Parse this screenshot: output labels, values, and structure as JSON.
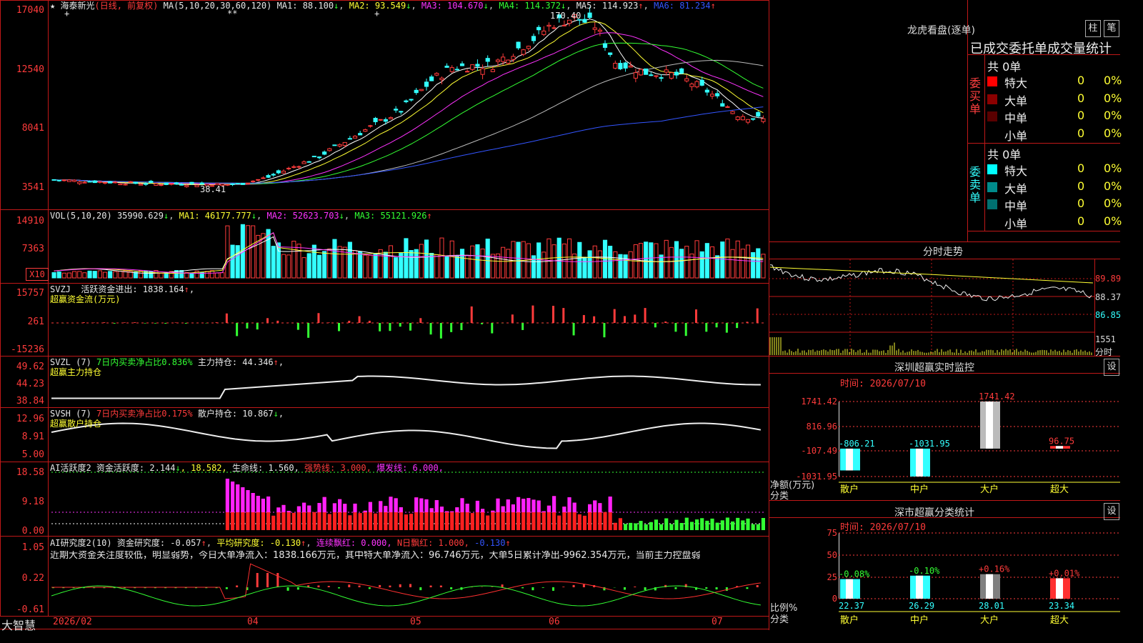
{
  "colors": {
    "up": "#ff3b3b",
    "down": "#33ffff",
    "border": "#c01818",
    "ma1": "#ffffff",
    "ma2": "#ffff33",
    "ma3": "#ff33ff",
    "ma4": "#33ff33",
    "ma5": "#bbbbbb",
    "ma6": "#3355ff"
  },
  "main": {
    "ticks": [
      "17040",
      "12540",
      "8041",
      "3541"
    ],
    "legend": {
      "star": "★",
      "name": "海泰新光",
      "mode": "(日线, 前复权)",
      "ma_def": "MA(5,10,20,30,60,120)",
      "ma1": "MA1: 88.100",
      "ma1_arrow": "↓",
      "ma2": "MA2: 93.549",
      "ma2_arrow": "↓",
      "ma3": "MA3: 104.670",
      "ma3_arrow": "↓",
      "ma4": "MA4: 114.372",
      "ma4_arrow": "↓",
      "ma5": "MA5: 114.923",
      "ma5_arrow": "↑",
      "ma6": "MA6: 81.234",
      "ma6_arrow": "↑"
    },
    "high_label": "170.40",
    "low_label": "38.41",
    "marks": [
      "+",
      "**",
      "+"
    ]
  },
  "vol": {
    "ticks": [
      "14910",
      "7363",
      "X10"
    ],
    "legend": {
      "def": "VOL(5,10,20)",
      "val": "35990.629",
      "val_arrow": "↓",
      "ma1": "MA1: 46177.777",
      "ma1_arrow": "↓",
      "ma2": "MA2: 52623.703",
      "ma2_arrow": "↓",
      "ma3": "MA3: 55121.926",
      "ma3_arrow": "↑"
    }
  },
  "svzj": {
    "ticks": [
      "15757",
      "261",
      "-15236"
    ],
    "legend": {
      "def": "SVZJ",
      "name": "活跃资金进出: 1838.164",
      "arrow": "↑",
      "comma": ",",
      "sub": "超赢资金流(万元)"
    }
  },
  "svzl": {
    "ticks": [
      "49.62",
      "44.23",
      "38.84"
    ],
    "legend": {
      "def": "SVZL  (7)",
      "ratio": "7日内买卖净占比0.836%",
      "hold": "主力持仓: 44.346",
      "arrow": "↑",
      "comma": ",",
      "sub": "超赢主力持仓"
    }
  },
  "svsh": {
    "ticks": [
      "12.96",
      "8.91",
      "5.00"
    ],
    "legend": {
      "def": "SVSH  (7)",
      "ratio": "7日内买卖净占比0.175%",
      "hold": "散户持仓: 10.867",
      "arrow": "↓",
      "comma": ",",
      "sub": "超赢散户持仓"
    }
  },
  "ai1": {
    "ticks": [
      "18.58",
      "9.18",
      "0.00"
    ],
    "legend": {
      "def": "AI活跃度2",
      "act": "资金活跃度: 2.144",
      "act_arrow": "↓",
      "v2": ", 18.582,",
      "life": "生命线: 1.560,",
      "strong": "强势线: 3.000,",
      "burst": "爆发线: 6.000,"
    }
  },
  "ai2": {
    "ticks": [
      "1.05",
      "0.22",
      "-0.61"
    ],
    "legend": {
      "def": "AI研究度2(10)",
      "res": "资金研究度: -0.057",
      "res_arrow": "↑",
      "avg": "平均研究度: -0.130",
      "avg_arrow": "↑",
      "red": "连续飘红: 0.000,",
      "n": "N日飘红: 1.000,",
      "last": "-0.130",
      "last_arrow": "↑"
    },
    "comment": "近期大资金关注度较低，明显弱势，今日大单净流入：1838.166万元，其中特大单净流入：96.746万元，大单5日累计净出-9962.354万元，当前主力控盘弱"
  },
  "dates": {
    "start": "2026/02",
    "labels": [
      "04",
      "05",
      "06",
      "07"
    ]
  },
  "brand": "大智慧",
  "panel": {
    "title": "龙虎看盘(逐单)",
    "btn1": "柱",
    "btn2": "笔",
    "header": "已成交委托单成交量统计",
    "buy_label": "委买单",
    "sell_label": "委卖单",
    "buy_total": "共 0单",
    "sell_total": "共 0单",
    "buy_rows": [
      {
        "name": "特大",
        "count": "0",
        "pct": "0%",
        "color": "#ff0000"
      },
      {
        "name": "大单",
        "count": "0",
        "pct": "0%",
        "color": "#8b0000"
      },
      {
        "name": "中单",
        "count": "0",
        "pct": "0%",
        "color": "#5a0000"
      },
      {
        "name": "小单",
        "count": "0",
        "pct": "0%",
        "color": ""
      }
    ],
    "sell_rows": [
      {
        "name": "特大",
        "count": "0",
        "pct": "0%",
        "color": "#00ffff"
      },
      {
        "name": "大单",
        "count": "0",
        "pct": "0%",
        "color": "#008b8b"
      },
      {
        "name": "中单",
        "count": "0",
        "pct": "0%",
        "color": "#007070"
      },
      {
        "name": "小单",
        "count": "0",
        "pct": "0%",
        "color": ""
      }
    ]
  },
  "intraday": {
    "title": "分时走势",
    "p1": "89.89",
    "p2": "88.37",
    "p3": "86.85",
    "vol": "1551",
    "unit": "分时"
  },
  "monitor": {
    "title": "深圳超赢实时监控",
    "btn": "设",
    "time": "时间: 2026/07/10",
    "ticks": [
      "1741.42",
      "816.96",
      "-107.49",
      "-1031.95"
    ],
    "ylabel": "净额(万元)",
    "xlabel": "分类",
    "chart_data": {
      "type": "bar",
      "categories": [
        "散户",
        "中户",
        "大户",
        "超大"
      ],
      "values": [
        -806.21,
        -1031.95,
        1741.42,
        96.75
      ],
      "value_labels": [
        "-806.21",
        "-1031.95",
        "1741.42",
        "96.75"
      ],
      "ylim": [
        -1031.95,
        1741.42
      ]
    }
  },
  "classify": {
    "title": "深市超赢分类统计",
    "btn": "设",
    "time": "时间: 2026/07/10",
    "ticks": [
      "75",
      "50",
      "25",
      "0"
    ],
    "ylabel": "比例%",
    "xlabel": "分类",
    "chart_data": {
      "type": "bar",
      "categories": [
        "散户",
        "中户",
        "大户",
        "超大"
      ],
      "values": [
        22.37,
        26.29,
        28.01,
        23.34
      ],
      "value_labels": [
        "22.37",
        "26.29",
        "28.01",
        "23.34"
      ],
      "changes": [
        "-0.08%",
        "-0.10%",
        "+0.16%",
        "+0.01%"
      ],
      "ylim": [
        0,
        75
      ]
    }
  }
}
